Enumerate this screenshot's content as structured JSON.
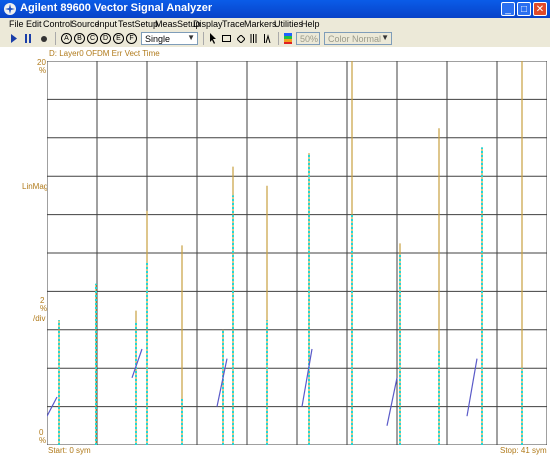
{
  "window": {
    "title": "Agilent 89600 Vector Signal Analyzer",
    "minimize": "_",
    "maximize": "□",
    "close": "✕"
  },
  "menu": [
    "File",
    "Edit",
    "Control",
    "Source",
    "Input",
    "TestSetup",
    "MeasSetup",
    "Display",
    "Trace",
    "Markers",
    "Utilities",
    "Help"
  ],
  "toolbar": {
    "trace_buttons": [
      "A",
      "B",
      "C",
      "D",
      "E",
      "F"
    ],
    "mode_select": "Single",
    "zoom": "50%",
    "color_mode": "Color Normal"
  },
  "trace": {
    "label": "D: Layer0 OFDM Err Vect Time",
    "y_top": "20",
    "y_top_unit": "%",
    "y_scale_name": "LinMag",
    "y_div": "2",
    "y_div_unit": "%",
    "y_div_label": "/div",
    "y_bottom": "0",
    "y_bottom_unit": "%",
    "start": "Start: 0  sym",
    "stop": "Stop: 41  sym"
  },
  "chart_data": {
    "type": "line",
    "ylabel": "LinMag",
    "ylim": [
      0,
      20
    ],
    "xlim": [
      0,
      41
    ],
    "x_divisions": 10,
    "y_divisions": 10,
    "grid": true,
    "colors": {
      "trace": "#20d8d8",
      "trace_line": "#5a5ac8",
      "vertical": "#c8a040",
      "grid": "#404040",
      "label": "#b07a1a"
    },
    "ramps": [
      {
        "x": [
          0,
          1
        ],
        "y": [
          1.5,
          2.5
        ]
      },
      {
        "x": [
          8.5,
          9.5
        ],
        "y": [
          3.5,
          5.0
        ]
      },
      {
        "x": [
          17.0,
          18.0
        ],
        "y": [
          2.0,
          4.5
        ]
      },
      {
        "x": [
          25.5,
          26.5
        ],
        "y": [
          2.0,
          5.0
        ]
      },
      {
        "x": [
          34.0,
          35.0
        ],
        "y": [
          1.0,
          3.5
        ]
      },
      {
        "x": [
          42.0,
          43.0
        ],
        "y": [
          1.5,
          4.5
        ]
      }
    ],
    "spikes": [
      {
        "x": 1.2,
        "peak": 6.5,
        "cyan_top": 6.5
      },
      {
        "x": 4.9,
        "peak": 8.4,
        "cyan_top": 8.4
      },
      {
        "x": 8.9,
        "peak": 7.0,
        "cyan_top": 6.4
      },
      {
        "x": 10.0,
        "peak": 12.2,
        "cyan_top": 9.5
      },
      {
        "x": 13.5,
        "peak": 10.4,
        "cyan_top": 2.5
      },
      {
        "x": 17.6,
        "peak": 6.0,
        "cyan_top": 6.0
      },
      {
        "x": 18.6,
        "peak": 14.5,
        "cyan_top": 13.0
      },
      {
        "x": 22.0,
        "peak": 13.5,
        "cyan_top": 6.5
      },
      {
        "x": 26.2,
        "peak": 15.2,
        "cyan_top": 15.2
      },
      {
        "x": 30.5,
        "peak": 20.0,
        "cyan_top": 12.0
      },
      {
        "x": 35.3,
        "peak": 10.5,
        "cyan_top": 10.0
      },
      {
        "x": 39.2,
        "peak": 16.5,
        "cyan_top": 5.0
      },
      {
        "x": 43.5,
        "peak": 15.5,
        "cyan_top": 15.5
      },
      {
        "x": 47.5,
        "peak": 20.0,
        "cyan_top": 4.0
      }
    ]
  }
}
